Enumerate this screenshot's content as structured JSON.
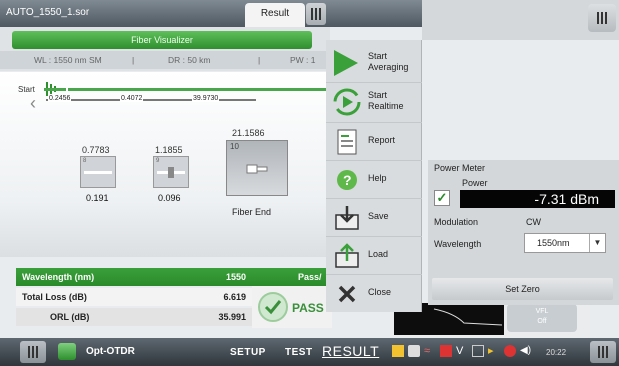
{
  "window": {
    "file_name": "AUTO_1550_1.sor",
    "result_tab": "Result"
  },
  "fiber_visualizer": {
    "title": "Fiber Visualizer",
    "params": {
      "wl": "WL : 1550 nm SM",
      "dr": "DR : 50 km",
      "pw": "PW : 1"
    },
    "start_label": "Start",
    "segments": [
      "0.2456",
      "0.4072",
      "39.9730"
    ],
    "events": [
      {
        "top": "0.7783",
        "bottom": "0.191"
      },
      {
        "top": "1.1855",
        "bottom": "0.096"
      },
      {
        "top": "21.1586",
        "bottom": "Fiber End",
        "small": "10"
      }
    ],
    "event_small_labels": [
      "8",
      "9"
    ]
  },
  "results": {
    "rows": [
      {
        "key": "Wavelength (nm)",
        "value": "1550"
      },
      {
        "key": "Total Loss (dB)",
        "value": "6.619"
      },
      {
        "key": "ORL (dB)",
        "value": "35.991"
      }
    ],
    "pass_header": "Pass/",
    "pass_text": "PASS",
    "vfl_label": "VFL",
    "vfl_state": "Off"
  },
  "menu": {
    "items": [
      {
        "label": "Start Averaging"
      },
      {
        "label": "Start Realtime"
      },
      {
        "label": "Report"
      },
      {
        "label": "Help"
      },
      {
        "label": "Save"
      },
      {
        "label": "Load"
      },
      {
        "label": "Close"
      }
    ]
  },
  "power_meter": {
    "title": "Power Meter",
    "power_label": "Power",
    "enabled": true,
    "reading": "-7.31 dBm",
    "modulation_label": "Modulation",
    "modulation_value": "CW",
    "wavelength_label": "Wavelength",
    "wavelength_value": "1550nm",
    "set_zero_label": "Set Zero"
  },
  "taskbar": {
    "app_name": "Opt-OTDR",
    "menu": [
      "SETUP",
      "TEST",
      "RESULT"
    ],
    "active": "RESULT",
    "clock": "20:22"
  },
  "colors": {
    "accent_green": "#3aa03a",
    "readout_bg": "#050505"
  }
}
